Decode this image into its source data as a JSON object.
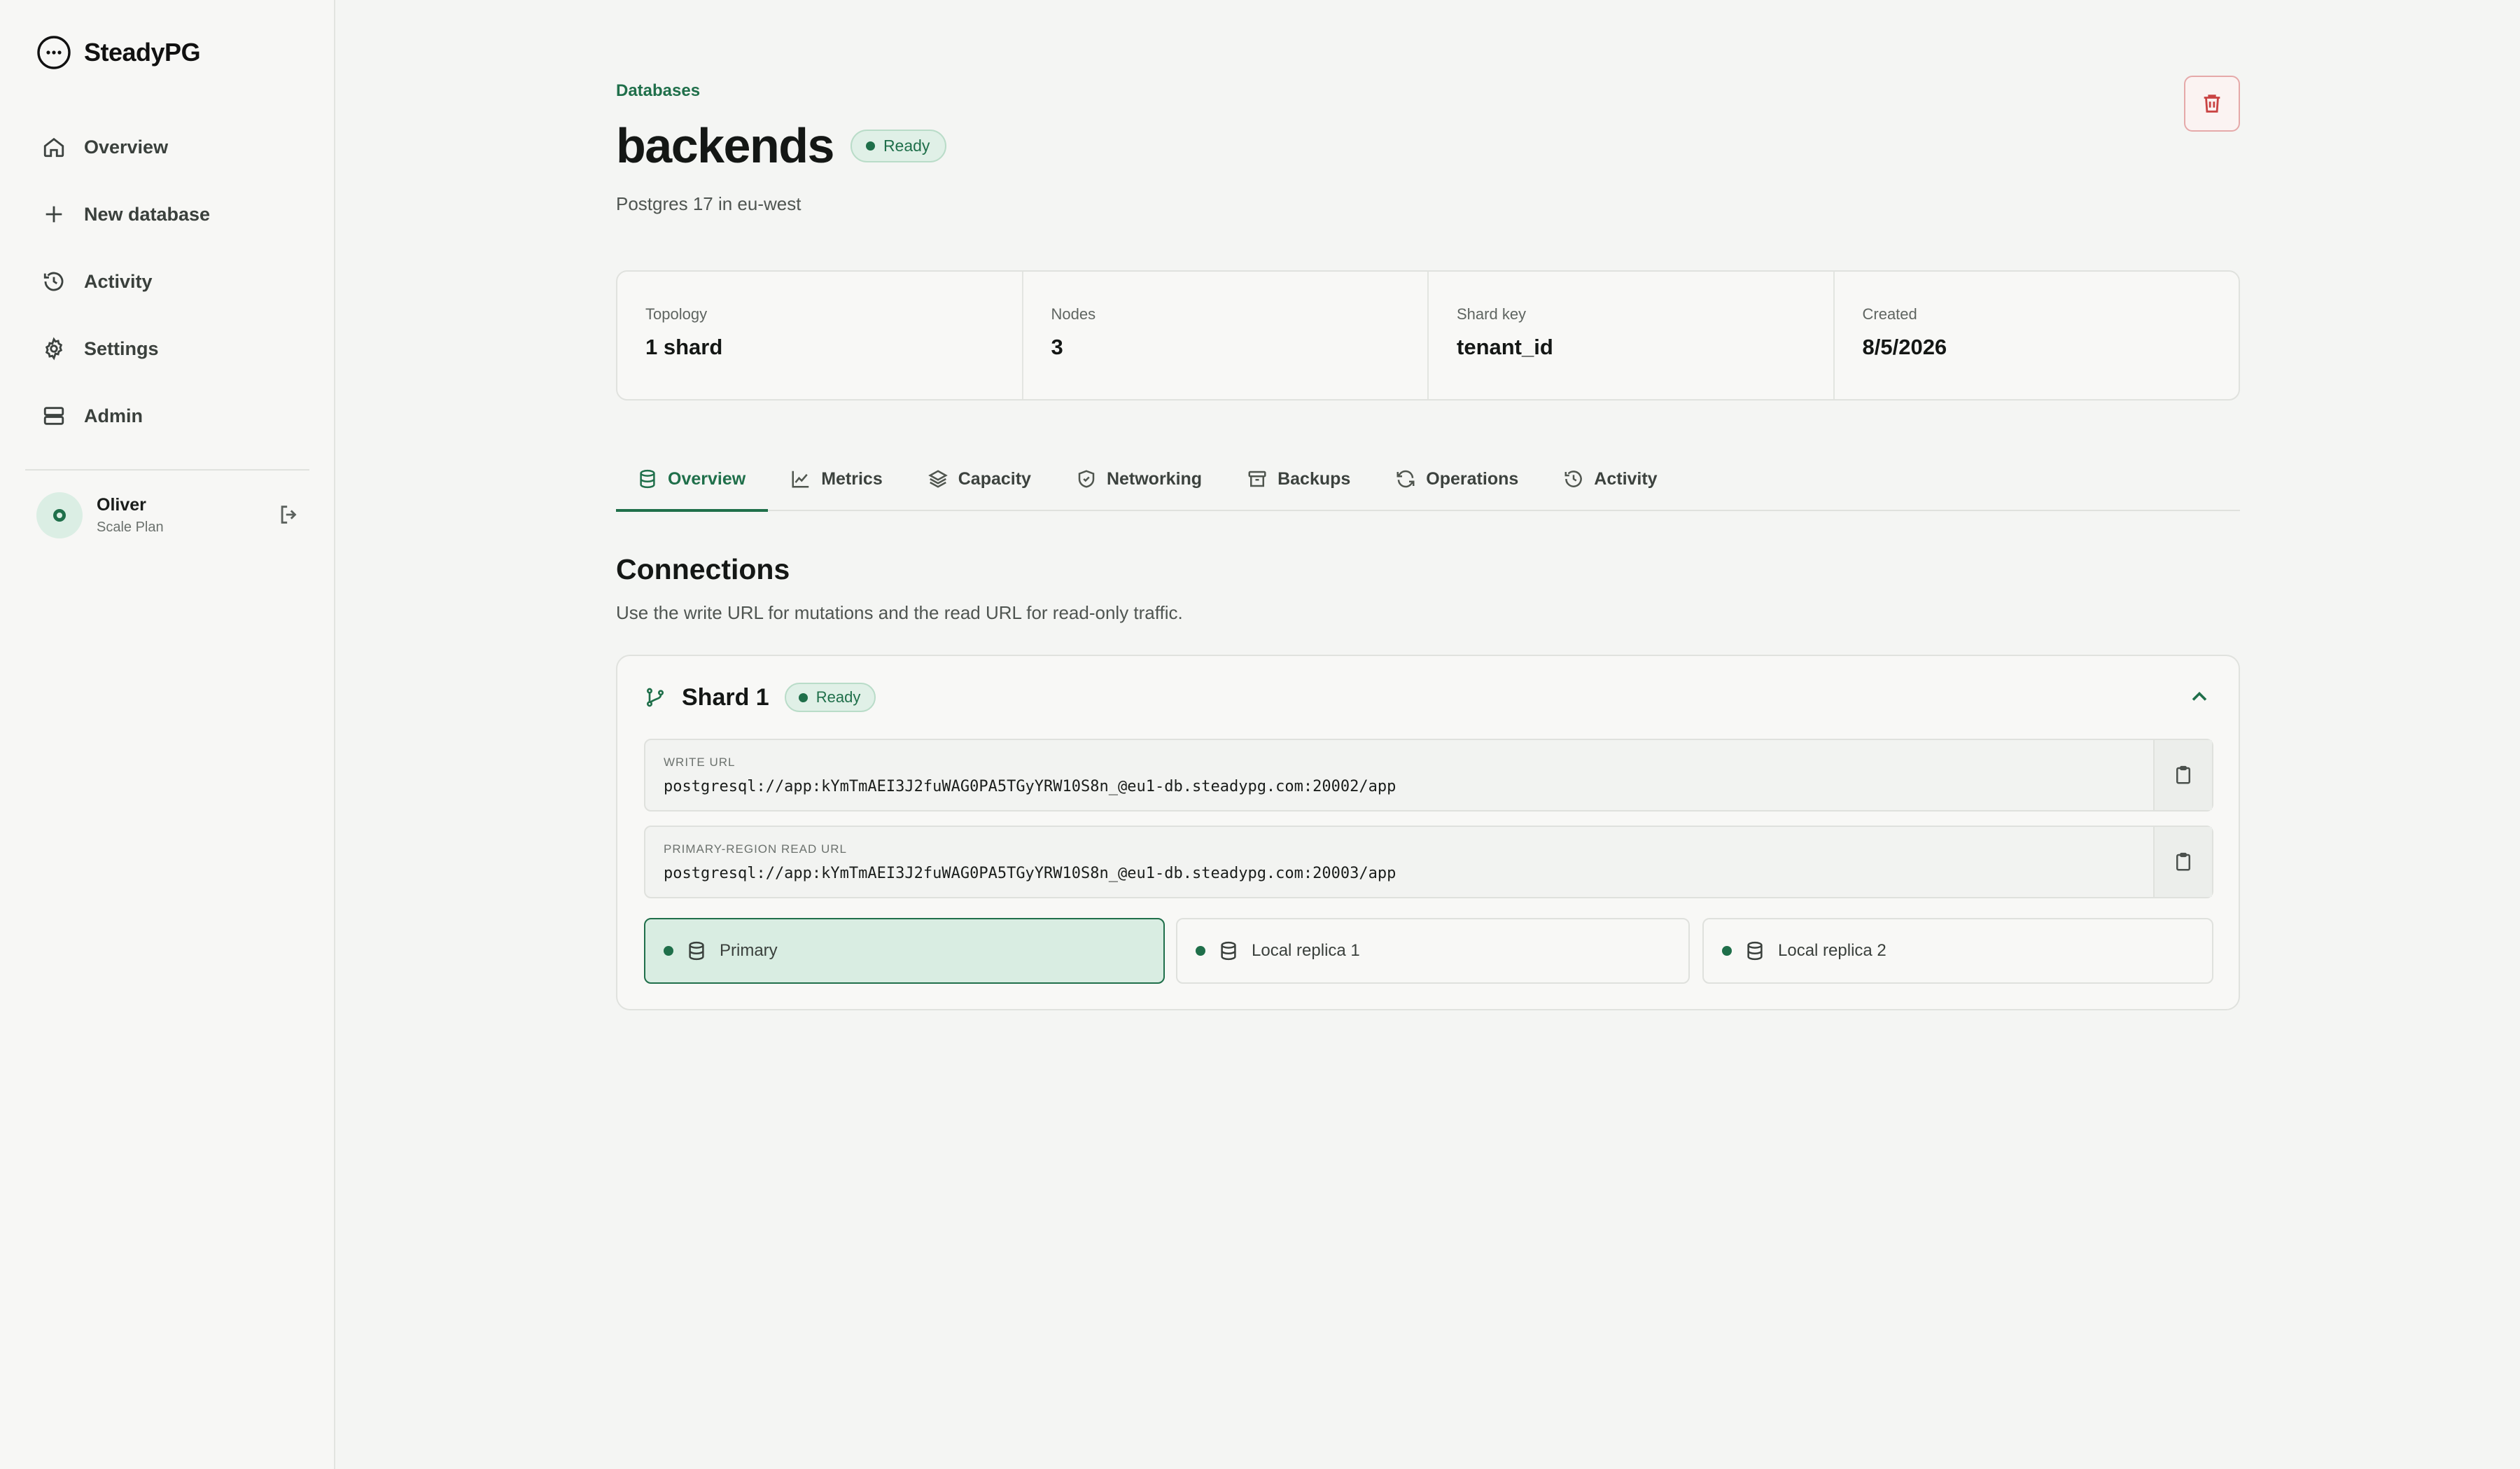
{
  "app": {
    "name": "SteadyPG"
  },
  "sidebar": {
    "items": [
      {
        "label": "Overview",
        "icon": "home-icon"
      },
      {
        "label": "New database",
        "icon": "plus-icon"
      },
      {
        "label": "Activity",
        "icon": "history-icon"
      },
      {
        "label": "Settings",
        "icon": "gear-icon"
      },
      {
        "label": "Admin",
        "icon": "server-icon"
      }
    ],
    "user": {
      "name": "Oliver",
      "plan": "Scale Plan"
    }
  },
  "header": {
    "breadcrumb": "Databases",
    "title": "backends",
    "status": "Ready",
    "subtitle": "Postgres 17 in eu-west"
  },
  "stats": [
    {
      "label": "Topology",
      "value": "1 shard"
    },
    {
      "label": "Nodes",
      "value": "3"
    },
    {
      "label": "Shard key",
      "value": "tenant_id"
    },
    {
      "label": "Created",
      "value": "8/5/2026"
    }
  ],
  "tabs": [
    {
      "label": "Overview",
      "icon": "database-icon",
      "active": true
    },
    {
      "label": "Metrics",
      "icon": "line-chart-icon"
    },
    {
      "label": "Capacity",
      "icon": "layers-icon"
    },
    {
      "label": "Networking",
      "icon": "shield-icon"
    },
    {
      "label": "Backups",
      "icon": "archive-icon"
    },
    {
      "label": "Operations",
      "icon": "refresh-icon"
    },
    {
      "label": "Activity",
      "icon": "history-icon"
    }
  ],
  "connections": {
    "title": "Connections",
    "description": "Use the write URL for mutations and the read URL for read-only traffic.",
    "shard": {
      "title": "Shard 1",
      "status": "Ready",
      "write": {
        "label": "WRITE URL",
        "value": "postgresql://app:kYmTmAEI3J2fuWAG0PA5TGyYRW10S8n_@eu1-db.steadypg.com:20002/app"
      },
      "read": {
        "label": "PRIMARY-REGION READ URL",
        "value": "postgresql://app:kYmTmAEI3J2fuWAG0PA5TGyYRW10S8n_@eu1-db.steadypg.com:20003/app"
      },
      "nodes": [
        {
          "label": "Primary",
          "selected": true
        },
        {
          "label": "Local replica 1"
        },
        {
          "label": "Local replica 2"
        }
      ]
    }
  },
  "colors": {
    "accent": "#1f6f4a",
    "danger": "#c94343",
    "badge_bg": "#e0f0e7"
  }
}
